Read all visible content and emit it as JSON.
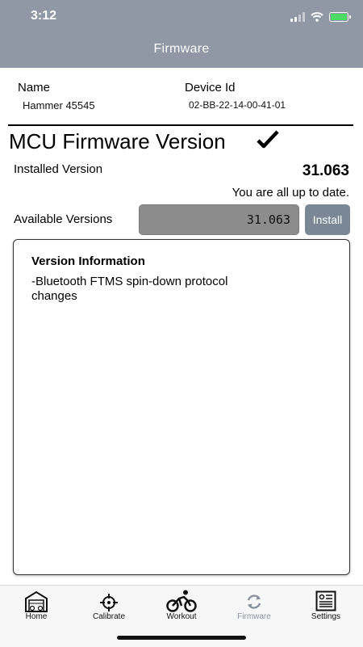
{
  "status_bar": {
    "time": "3:12"
  },
  "nav": {
    "title": "Firmware"
  },
  "device": {
    "name_label": "Name",
    "name_value": "Hammer 45545",
    "id_label": "Device Id",
    "id_value": "02-BB-22-14-00-41-01"
  },
  "mcu": {
    "title": "MCU Firmware Version",
    "installed_label": "Installed Version",
    "installed_value": "31.063",
    "status_text": "You are all up to date.",
    "available_label": "Available Versions",
    "available_value": "31.063",
    "install_label": "Install"
  },
  "info": {
    "title": "Version Information",
    "text": "-Bluetooth FTMS spin-down protocol changes"
  },
  "tabs": [
    {
      "label": "Home",
      "icon": "garage-icon"
    },
    {
      "label": "Calibrate",
      "icon": "crosshair-icon"
    },
    {
      "label": "Workout",
      "icon": "cyclist-icon"
    },
    {
      "label": "Firmware",
      "icon": "refresh-icon",
      "active": true
    },
    {
      "label": "Settings",
      "icon": "settings-panel-icon"
    }
  ],
  "colors": {
    "header": "#8f98a4",
    "field": "#8c8c8c",
    "button": "#7a8896",
    "battery": "#4cd964"
  }
}
